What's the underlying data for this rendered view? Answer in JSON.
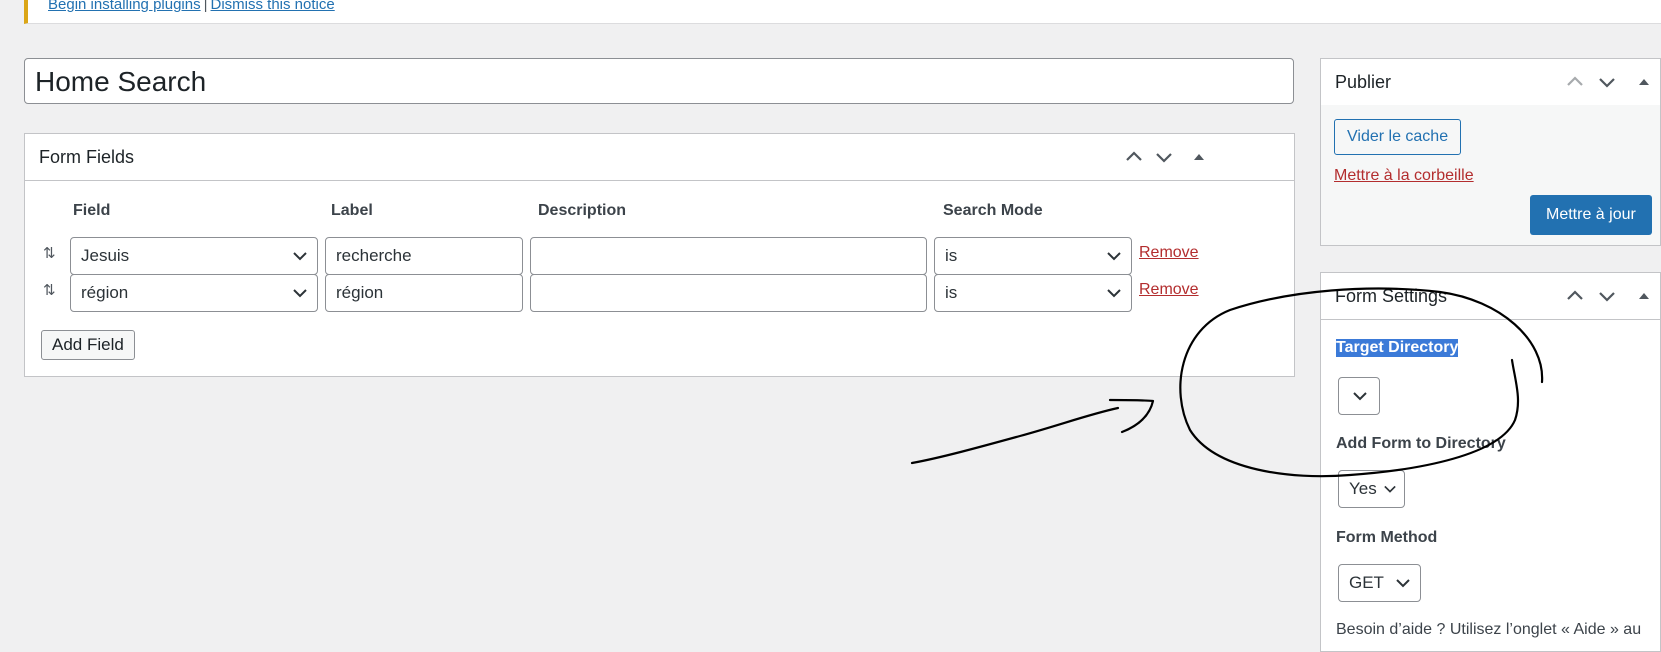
{
  "notice": {
    "begin_link": "Begin installing plugins",
    "separator": "|",
    "dismiss_link": "Dismiss this notice"
  },
  "title": "Home Search",
  "form_fields": {
    "heading": "Form Fields",
    "columns": [
      "Field",
      "Label",
      "Description",
      "Search Mode"
    ],
    "rows": [
      {
        "field": "Jesuis",
        "label": "recherche",
        "description": "",
        "mode": "is",
        "remove": "Remove"
      },
      {
        "field": "région",
        "label": "région",
        "description": "",
        "mode": "is",
        "remove": "Remove"
      }
    ],
    "add_button": "Add Field"
  },
  "publish": {
    "heading": "Publier",
    "clear_cache": "Vider le cache",
    "trash": "Mettre à la corbeille",
    "update": "Mettre à jour"
  },
  "settings": {
    "heading": "Form Settings",
    "target_directory_label": "Target Directory",
    "target_directory_value": "",
    "add_form_label": "Add Form to Directory",
    "add_form_value": "Yes",
    "method_label": "Form Method",
    "method_value": "GET",
    "help_text": "Besoin d’aide ? Utilisez l’onglet « Aide » au"
  },
  "colors": {
    "accent": "#2271b1",
    "danger": "#b32d2e",
    "notice_border": "#dba617",
    "selection": "#3b7ad8"
  }
}
